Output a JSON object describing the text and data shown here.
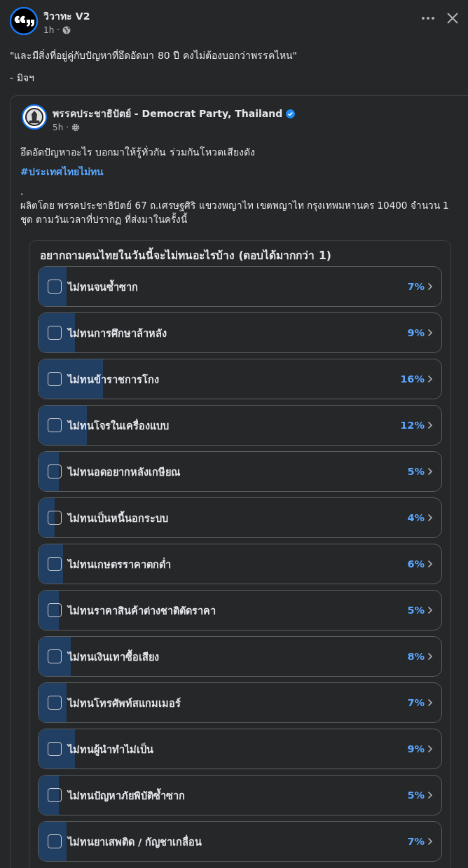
{
  "post": {
    "author": "วิวาทะ V2",
    "time": "1h",
    "separator": "·",
    "text": "\"และมีสิ่งที่อยู่คู่กับปัญหาที่อึดอัดมา 80 ปี คงไม่ต้องบอกว่าพรรคไหน\"",
    "signature": "- มิจฯ"
  },
  "shared_post": {
    "author": "พรรคประชาธิปัตย์ - Democrat Party, Thailand",
    "verified": true,
    "time": "5h",
    "separator": "·",
    "text": "อึดอัดปัญหาอะไร บอกมาให้รู้ทั่วกัน ร่วมกันโหวตเสียงดัง",
    "hashtag": "#ประเทศไทยไม่ทน",
    "dot": ".",
    "credit": "ผลิตโดย พรรคประชาธิปัตย์ 67 ถ.เศรษฐศิริ แขวงพญาไท เขตพญาไท กรุงเทพมหานคร 10400  จำนวน 1 ชุด ตามวันเวลาที่ปรากฏ ที่ส่งมาในครั้งนี้"
  },
  "poll": {
    "question": "อยากถามคนไทยในวันนี้จะไม่ทนอะไรบ้าง (ตอบได้มากกว่า 1)",
    "options": [
      {
        "label": "ไม่ทนจนซ้ำซาก",
        "percent": "7%",
        "level": 0.07,
        "checked": false
      },
      {
        "label": "ไม่ทนการศึกษาล้าหลัง",
        "percent": "9%",
        "level": 0.09,
        "checked": false
      },
      {
        "label": "ไม่ทนข้าราชการโกง",
        "percent": "16%",
        "level": 0.16,
        "checked": false
      },
      {
        "label": "ไม่ทนโจรในเครื่องแบบ",
        "percent": "12%",
        "level": 0.12,
        "checked": false
      },
      {
        "label": "ไม่ทนอดอยากหลังเกษียณ",
        "percent": "5%",
        "level": 0.05,
        "checked": false
      },
      {
        "label": "ไม่ทนเป็นหนี้นอกระบบ",
        "percent": "4%",
        "level": 0.04,
        "checked": false
      },
      {
        "label": "ไม่ทนเกษตรราคาตกต่ำ",
        "percent": "6%",
        "level": 0.06,
        "checked": false
      },
      {
        "label": "ไม่ทนราคาสินค้าต่างชาติตัดราคา",
        "percent": "5%",
        "level": 0.05,
        "checked": false
      },
      {
        "label": "ไม่ทนเงินเทาซื้อเสียง",
        "percent": "8%",
        "level": 0.08,
        "checked": false
      },
      {
        "label": "ไม่ทนโทรศัพท์สแกมเมอร์",
        "percent": "7%",
        "level": 0.07,
        "checked": false
      },
      {
        "label": "ไม่ทนผู้นำทำไม่เป็น",
        "percent": "9%",
        "level": 0.09,
        "checked": false
      },
      {
        "label": "ไม่ทนปัญหาภัยพิบัติซ้ำซาก",
        "percent": "5%",
        "level": 0.05,
        "checked": false
      },
      {
        "label": "ไม่ทนยาเสพติด / กัญชาเกลื่อน",
        "percent": "7%",
        "level": 0.07,
        "checked": false
      }
    ]
  }
}
